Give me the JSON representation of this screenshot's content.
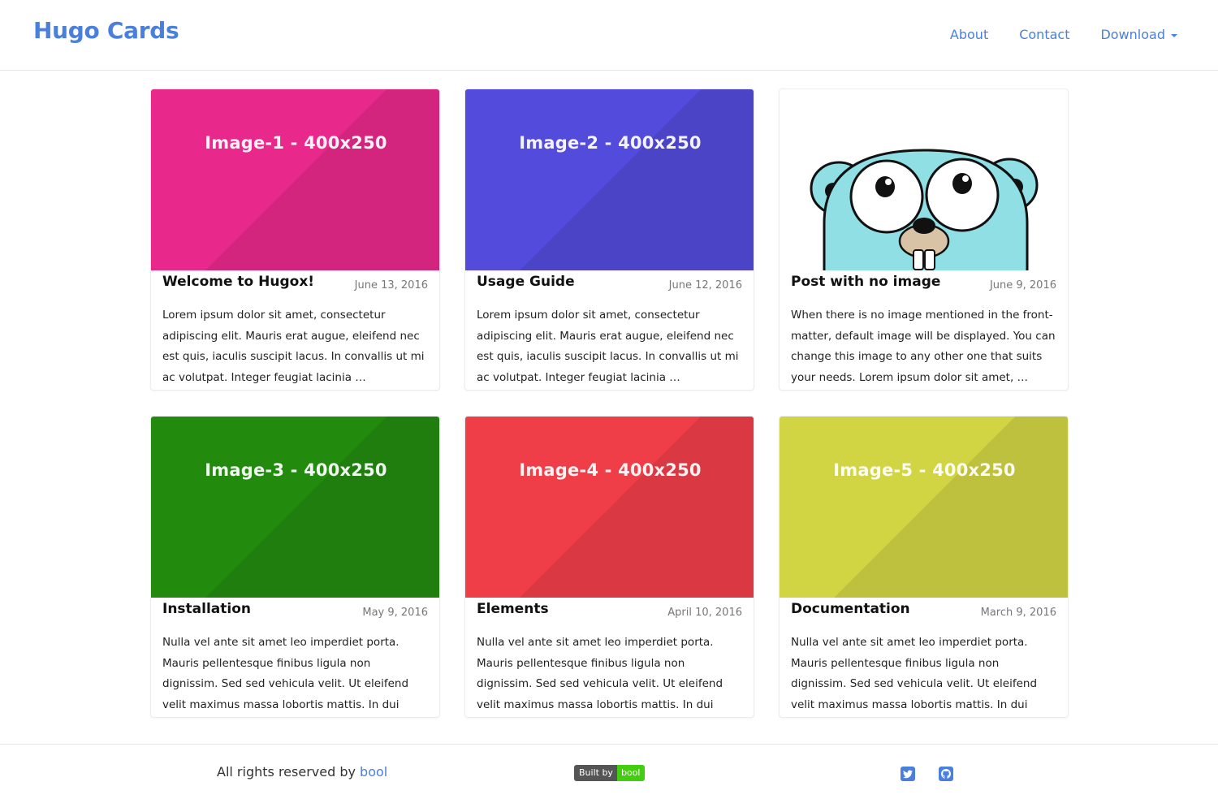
{
  "navbar": {
    "brand": "Hugo Cards",
    "links": [
      {
        "label": "About"
      },
      {
        "label": "Contact"
      },
      {
        "label": "Download"
      }
    ]
  },
  "cards": [
    {
      "title": "Welcome to Hugox!",
      "date": "June 13, 2016",
      "image_label": "Image-1 - 400x250",
      "image_color": "#e8288a",
      "excerpt": "Lorem ipsum dolor sit amet, consectetur adipiscing elit. Mauris erat augue, eleifend nec est quis, iaculis suscipit lacus. In convallis ut mi ac volutpat. Integer feugiat lacinia …"
    },
    {
      "title": "Usage Guide",
      "date": "June 12, 2016",
      "image_label": "Image-2 - 400x250",
      "image_color": "#534bdb",
      "excerpt": "Lorem ipsum dolor sit amet, consectetur adipiscing elit. Mauris erat augue, eleifend nec est quis, iaculis suscipit lacus. In convallis ut mi ac volutpat. Integer feugiat lacinia …"
    },
    {
      "title": "Post with no image",
      "date": "June 9, 2016",
      "image_label": "",
      "image_color": "#ffffff",
      "excerpt": "When there is no image mentioned in the front-matter, default image will be displayed. You can change this image to any other one that suits your needs. Lorem ipsum dolor sit amet, …"
    },
    {
      "title": "Installation",
      "date": "May 9, 2016",
      "image_label": "Image-3 - 400x250",
      "image_color": "#228b0e",
      "excerpt": "Nulla vel ante sit amet leo imperdiet porta. Mauris pellentesque finibus ligula non dignissim. Sed sed vehicula velit. Ut eleifend velit maximus massa lobortis mattis. In dui quam, …"
    },
    {
      "title": "Elements",
      "date": "April 10, 2016",
      "image_label": "Image-4 - 400x250",
      "image_color": "#ef3e48",
      "excerpt": "Nulla vel ante sit amet leo imperdiet porta. Mauris pellentesque finibus ligula non dignissim. Sed sed vehicula velit. Ut eleifend velit maximus massa lobortis mattis. In dui quam, …"
    },
    {
      "title": "Documentation",
      "date": "March 9, 2016",
      "image_label": "Image-5 - 400x250",
      "image_color": "#d1d443",
      "excerpt": "Nulla vel ante sit amet leo imperdiet porta. Mauris pellentesque finibus ligula non dignissim. Sed sed vehicula velit. Ut eleifend velit maximus massa lobortis mattis. In dui quam, …"
    }
  ],
  "footer": {
    "copyright_prefix": "All rights reserved by",
    "copyright_link": "bool",
    "badge_left": "Built by",
    "badge_right": "bool",
    "social_icons": [
      "twitter-icon",
      "github-icon"
    ]
  },
  "colors": {
    "accent": "#4a7fdc",
    "badge_green": "#44cc11"
  }
}
